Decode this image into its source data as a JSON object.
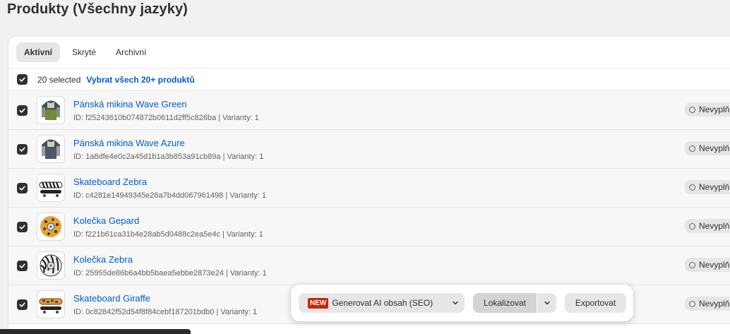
{
  "page": {
    "title": "Produkty (Všechny jazyky)"
  },
  "tabs": [
    {
      "label": "Aktivní",
      "active": true
    },
    {
      "label": "Skryté",
      "active": false
    },
    {
      "label": "Archivní",
      "active": false
    }
  ],
  "bulk": {
    "selected_text": "20 selected",
    "select_all_link": "Vybrat všech 20+ produktů",
    "checked": true
  },
  "products": [
    {
      "name": "Pánská mikina Wave Green",
      "meta": "ID: f25243610b074872b0611d2ff5c826ba | Varianty: 1",
      "status": "Nevyplň",
      "thumb": "hoodie-green",
      "checked": true
    },
    {
      "name": "Pánská mikina Wave Azure",
      "meta": "ID: 1a8dfe4e0c2a45d1b1a3b853a91cb89a | Varianty: 1",
      "status": "Nevyplň",
      "thumb": "hoodie-azure",
      "checked": true
    },
    {
      "name": "Skateboard Zebra",
      "meta": "ID: c4281e14949345e28a7b4dd067961498 | Varianty: 1",
      "status": "Nevyplň",
      "thumb": "skateboard-zebra",
      "checked": true
    },
    {
      "name": "Kolečka Gepard",
      "meta": "ID: f221b61ca31b4e28ab5d0488c2ea5e4c | Varianty: 1",
      "status": "Nevyplň",
      "thumb": "wheel-cheetah",
      "checked": true
    },
    {
      "name": "Kolečka Zebra",
      "meta": "ID: 25955de86b6a4bb5baea5ebbe2873e24 | Varianty: 1",
      "status": "Nevyplň",
      "thumb": "wheel-zebra",
      "checked": true
    },
    {
      "name": "Skateboard Giraffe",
      "meta": "ID: 0c82842f52d54f8f84cebf187201bdb0 | Varianty: 1",
      "status": "Nevyplň",
      "thumb": "skateboard-giraffe",
      "checked": true
    }
  ],
  "action_bar": {
    "new_badge": "NEW",
    "generate_label": "Generovat AI obsah (SEO)",
    "localize_label": "Lokalizovat",
    "export_label": "Exportovat"
  },
  "colors": {
    "link": "#005bd3",
    "new_badge": "#c5280c",
    "checkbox": "#303030"
  }
}
